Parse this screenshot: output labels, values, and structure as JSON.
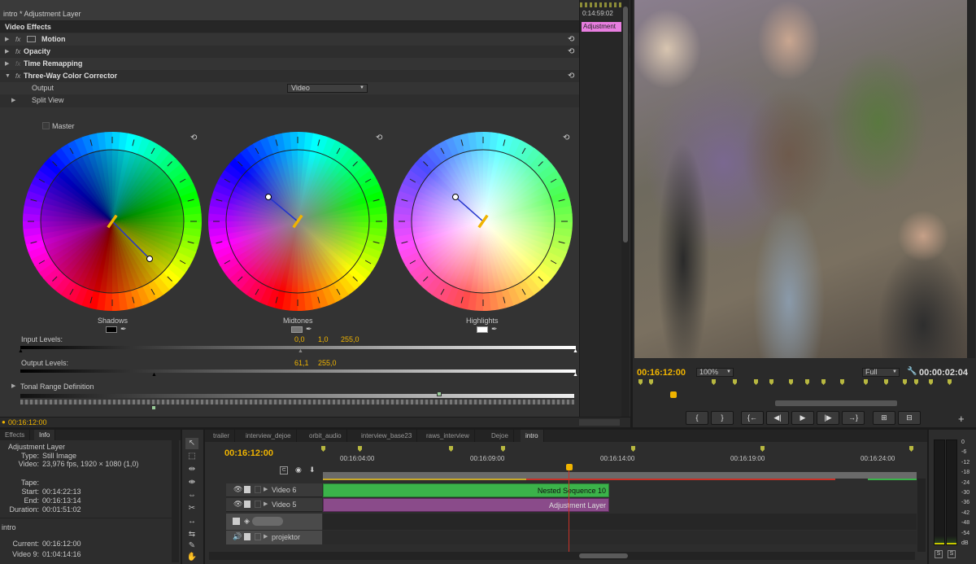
{
  "effect_controls": {
    "title": "intro * Adjustment Layer",
    "section_label": "Video Effects",
    "effects": [
      {
        "name": "Motion"
      },
      {
        "name": "Opacity"
      },
      {
        "name": "Time Remapping"
      },
      {
        "name": "Three-Way Color Corrector"
      }
    ],
    "output_label": "Output",
    "output_value": "Video",
    "split_view_label": "Split View",
    "master_label": "Master",
    "wheels": [
      {
        "name": "Shadows"
      },
      {
        "name": "Midtones"
      },
      {
        "name": "Highlights"
      }
    ],
    "input_levels_label": "Input Levels:",
    "input_levels_values": [
      "0,0",
      "1,0",
      "255,0"
    ],
    "output_levels_label": "Output Levels:",
    "output_levels_values": [
      "61,1",
      "255,0"
    ],
    "tonal_range_label": "Tonal Range Definition",
    "timecode": "00:16:12:00",
    "mini_timeline_time": "0:14:59:02",
    "mini_clip_label": "Adjustment"
  },
  "program_monitor": {
    "timecode": "00:16:12:00",
    "zoom": "100%",
    "quality": "Full",
    "duration": "00:00:02:04"
  },
  "info_panel": {
    "tabs": [
      "Effects",
      "Info"
    ],
    "title": "Adjustment Layer",
    "rows": [
      {
        "key": "Type:",
        "value": "Still Image"
      },
      {
        "key": "Video:",
        "value": "23,976 fps, 1920 × 1080 (1,0)"
      },
      {
        "key": "Tape:",
        "value": ""
      },
      {
        "key": "Start:",
        "value": "00:14:22:13"
      },
      {
        "key": "End:",
        "value": "00:16:13:14"
      },
      {
        "key": "Duration:",
        "value": "00:01:51:02"
      }
    ],
    "sequence": "intro",
    "current_label": "Current:",
    "current_value": "00:16:12:00",
    "video9_label": "Video 9:",
    "video9_value": "01:04:14:16"
  },
  "timeline": {
    "tabs": [
      "trailer",
      "interview_dejoe",
      "orbit_audio",
      "interview_base23",
      "raws_interview",
      "Dejoe",
      "intro"
    ],
    "timecode": "00:16:12:00",
    "ruler": [
      "00:16:04:00",
      "00:16:09:00",
      "00:16:14:00",
      "00:16:19:00",
      "00:16:24:00"
    ],
    "tracks": [
      {
        "name": "Video 6",
        "clip": "Nested Sequence 10"
      },
      {
        "name": "Video 5",
        "clip": "Adjustment Layer"
      },
      {
        "name": "projektor",
        "clip": ""
      }
    ]
  },
  "audio_meter": {
    "scale": [
      "0",
      "-6",
      "-12",
      "-18",
      "-24",
      "-30",
      "-36",
      "-42",
      "-48",
      "-54",
      "dB"
    ],
    "solo_buttons": [
      "S",
      "S"
    ]
  },
  "colors": {
    "accent_timecode": "#f0b400",
    "clip_green": "#3bb34a",
    "clip_purple": "#8a4b8a",
    "playhead": "#c83228"
  }
}
